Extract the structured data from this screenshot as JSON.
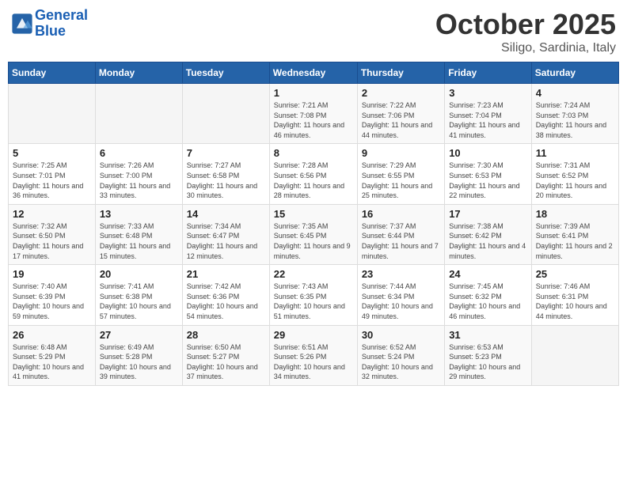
{
  "header": {
    "logo_line1": "General",
    "logo_line2": "Blue",
    "month_title": "October 2025",
    "location": "Siligo, Sardinia, Italy"
  },
  "weekdays": [
    "Sunday",
    "Monday",
    "Tuesday",
    "Wednesday",
    "Thursday",
    "Friday",
    "Saturday"
  ],
  "weeks": [
    [
      {
        "day": "",
        "info": ""
      },
      {
        "day": "",
        "info": ""
      },
      {
        "day": "",
        "info": ""
      },
      {
        "day": "1",
        "info": "Sunrise: 7:21 AM\nSunset: 7:08 PM\nDaylight: 11 hours\nand 46 minutes."
      },
      {
        "day": "2",
        "info": "Sunrise: 7:22 AM\nSunset: 7:06 PM\nDaylight: 11 hours\nand 44 minutes."
      },
      {
        "day": "3",
        "info": "Sunrise: 7:23 AM\nSunset: 7:04 PM\nDaylight: 11 hours\nand 41 minutes."
      },
      {
        "day": "4",
        "info": "Sunrise: 7:24 AM\nSunset: 7:03 PM\nDaylight: 11 hours\nand 38 minutes."
      }
    ],
    [
      {
        "day": "5",
        "info": "Sunrise: 7:25 AM\nSunset: 7:01 PM\nDaylight: 11 hours\nand 36 minutes."
      },
      {
        "day": "6",
        "info": "Sunrise: 7:26 AM\nSunset: 7:00 PM\nDaylight: 11 hours\nand 33 minutes."
      },
      {
        "day": "7",
        "info": "Sunrise: 7:27 AM\nSunset: 6:58 PM\nDaylight: 11 hours\nand 30 minutes."
      },
      {
        "day": "8",
        "info": "Sunrise: 7:28 AM\nSunset: 6:56 PM\nDaylight: 11 hours\nand 28 minutes."
      },
      {
        "day": "9",
        "info": "Sunrise: 7:29 AM\nSunset: 6:55 PM\nDaylight: 11 hours\nand 25 minutes."
      },
      {
        "day": "10",
        "info": "Sunrise: 7:30 AM\nSunset: 6:53 PM\nDaylight: 11 hours\nand 22 minutes."
      },
      {
        "day": "11",
        "info": "Sunrise: 7:31 AM\nSunset: 6:52 PM\nDaylight: 11 hours\nand 20 minutes."
      }
    ],
    [
      {
        "day": "12",
        "info": "Sunrise: 7:32 AM\nSunset: 6:50 PM\nDaylight: 11 hours\nand 17 minutes."
      },
      {
        "day": "13",
        "info": "Sunrise: 7:33 AM\nSunset: 6:48 PM\nDaylight: 11 hours\nand 15 minutes."
      },
      {
        "day": "14",
        "info": "Sunrise: 7:34 AM\nSunset: 6:47 PM\nDaylight: 11 hours\nand 12 minutes."
      },
      {
        "day": "15",
        "info": "Sunrise: 7:35 AM\nSunset: 6:45 PM\nDaylight: 11 hours\nand 9 minutes."
      },
      {
        "day": "16",
        "info": "Sunrise: 7:37 AM\nSunset: 6:44 PM\nDaylight: 11 hours\nand 7 minutes."
      },
      {
        "day": "17",
        "info": "Sunrise: 7:38 AM\nSunset: 6:42 PM\nDaylight: 11 hours\nand 4 minutes."
      },
      {
        "day": "18",
        "info": "Sunrise: 7:39 AM\nSunset: 6:41 PM\nDaylight: 11 hours\nand 2 minutes."
      }
    ],
    [
      {
        "day": "19",
        "info": "Sunrise: 7:40 AM\nSunset: 6:39 PM\nDaylight: 10 hours\nand 59 minutes."
      },
      {
        "day": "20",
        "info": "Sunrise: 7:41 AM\nSunset: 6:38 PM\nDaylight: 10 hours\nand 57 minutes."
      },
      {
        "day": "21",
        "info": "Sunrise: 7:42 AM\nSunset: 6:36 PM\nDaylight: 10 hours\nand 54 minutes."
      },
      {
        "day": "22",
        "info": "Sunrise: 7:43 AM\nSunset: 6:35 PM\nDaylight: 10 hours\nand 51 minutes."
      },
      {
        "day": "23",
        "info": "Sunrise: 7:44 AM\nSunset: 6:34 PM\nDaylight: 10 hours\nand 49 minutes."
      },
      {
        "day": "24",
        "info": "Sunrise: 7:45 AM\nSunset: 6:32 PM\nDaylight: 10 hours\nand 46 minutes."
      },
      {
        "day": "25",
        "info": "Sunrise: 7:46 AM\nSunset: 6:31 PM\nDaylight: 10 hours\nand 44 minutes."
      }
    ],
    [
      {
        "day": "26",
        "info": "Sunrise: 6:48 AM\nSunset: 5:29 PM\nDaylight: 10 hours\nand 41 minutes."
      },
      {
        "day": "27",
        "info": "Sunrise: 6:49 AM\nSunset: 5:28 PM\nDaylight: 10 hours\nand 39 minutes."
      },
      {
        "day": "28",
        "info": "Sunrise: 6:50 AM\nSunset: 5:27 PM\nDaylight: 10 hours\nand 37 minutes."
      },
      {
        "day": "29",
        "info": "Sunrise: 6:51 AM\nSunset: 5:26 PM\nDaylight: 10 hours\nand 34 minutes."
      },
      {
        "day": "30",
        "info": "Sunrise: 6:52 AM\nSunset: 5:24 PM\nDaylight: 10 hours\nand 32 minutes."
      },
      {
        "day": "31",
        "info": "Sunrise: 6:53 AM\nSunset: 5:23 PM\nDaylight: 10 hours\nand 29 minutes."
      },
      {
        "day": "",
        "info": ""
      }
    ]
  ]
}
